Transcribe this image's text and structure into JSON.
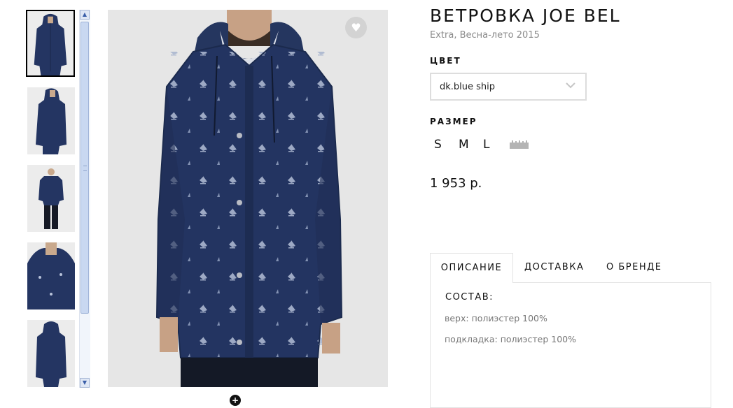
{
  "product": {
    "title": "ВЕТРОВКА JOE BEL",
    "subtitle": "Extra, Весна-лето 2015",
    "color_label": "ЦВЕТ",
    "color_value": "dk.blue ship",
    "size_label": "РАЗМЕР",
    "sizes": [
      "S",
      "M",
      "L"
    ],
    "price": "1 953 р."
  },
  "gallery": {
    "thumbnail_count": 5,
    "active_index": 0,
    "jacket_color": "#233461",
    "background_color": "#e6e6e6"
  },
  "tabs": [
    {
      "label": "ОПИСАНИЕ",
      "active": true
    },
    {
      "label": "ДОСТАВКА",
      "active": false
    },
    {
      "label": "О БРЕНДЕ",
      "active": false
    }
  ],
  "description": {
    "composition_title": "СОСТАВ:",
    "lines": [
      "верх: полиэстер 100%",
      "подкладка: полиэстер 100%"
    ]
  },
  "icons": {
    "favorite": "heart-icon",
    "zoom": "plus-icon",
    "size_chart": "ruler-icon",
    "dropdown": "chevron-down-icon"
  }
}
